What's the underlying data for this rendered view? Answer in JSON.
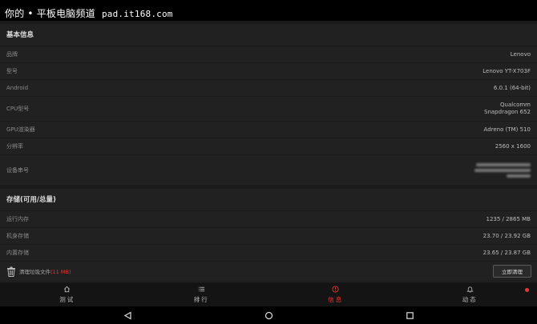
{
  "watermark": {
    "text": "你的 • 平板电脑频道",
    "site": "pad.it168.com"
  },
  "basic_info": {
    "title": "基本信息",
    "rows": [
      {
        "label": "品牌",
        "value": "Lenovo"
      },
      {
        "label": "型号",
        "value": "Lenovo YT-X703F"
      },
      {
        "label": "Android",
        "value": "6.0.1 (64-bit)"
      },
      {
        "label": "CPU型号",
        "value_line1": "Qualcomm",
        "value_line2": "Snapdragon 652"
      },
      {
        "label": "GPU渲染器",
        "value": "Adreno (TM) 510"
      },
      {
        "label": "分辨率",
        "value": "2560 x 1600"
      },
      {
        "label": "设备串号"
      }
    ]
  },
  "storage": {
    "title": "存储(可用/总量)",
    "rows": [
      {
        "label": "运行内存",
        "value": "1235 / 2865 MB"
      },
      {
        "label": "机身存储",
        "value": "23.70 / 23.92 GB"
      },
      {
        "label": "内置存储",
        "value": "23.65 / 23.87 GB"
      }
    ],
    "clean": {
      "text": "清理垃圾文件",
      "size": "(11 MB)",
      "button": "立即清理"
    }
  },
  "tabs": [
    {
      "label": "测试",
      "icon": "home-icon"
    },
    {
      "label": "排行",
      "icon": "list-icon"
    },
    {
      "label": "信息",
      "icon": "info-icon",
      "active": true
    },
    {
      "label": "动态",
      "icon": "bell-icon",
      "badge": true
    }
  ],
  "colors": {
    "accent": "#e53935",
    "background": "#1a1a1a",
    "card": "#212121"
  }
}
